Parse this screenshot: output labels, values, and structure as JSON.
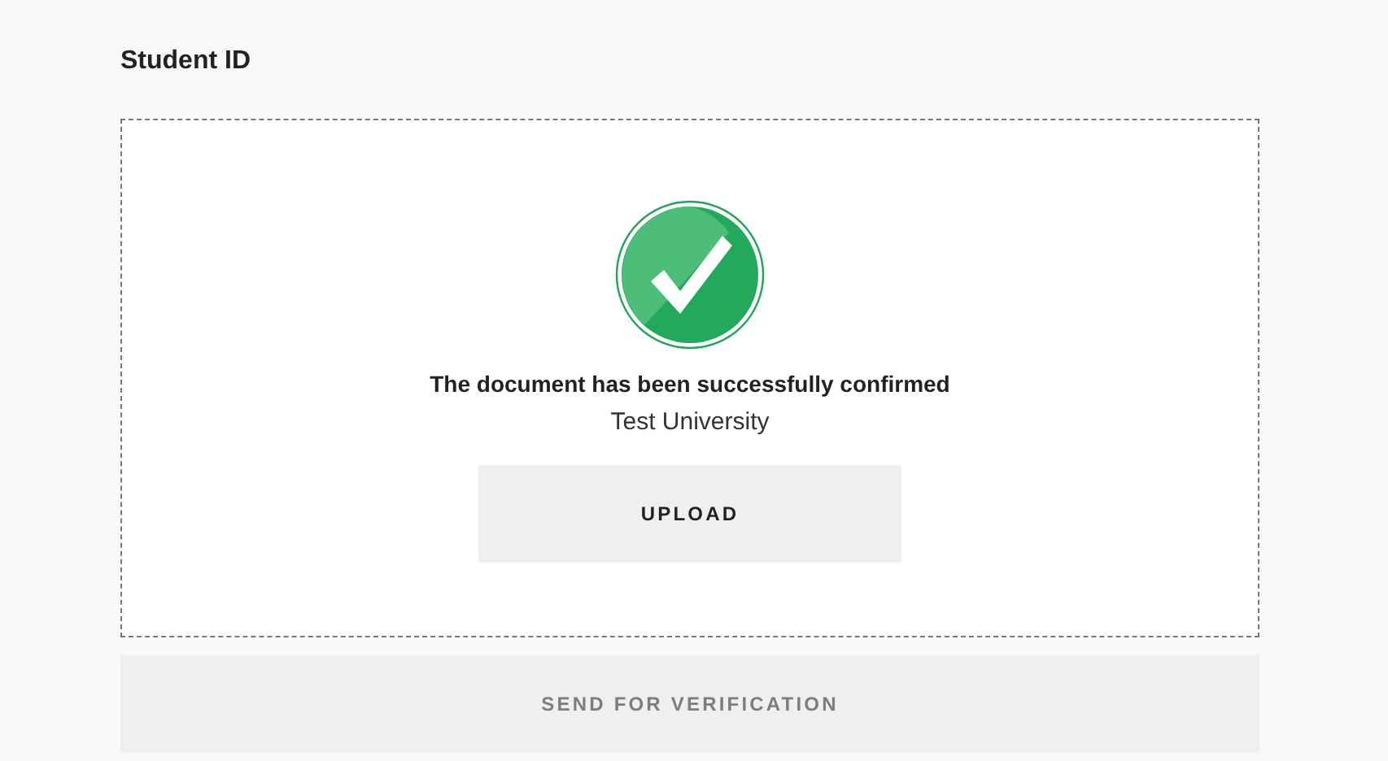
{
  "section": {
    "title": "Student ID"
  },
  "upload_area": {
    "kind": "confirmed",
    "message": "The document has been successfully confirmed",
    "institution": "Test University",
    "upload_button": "UPLOAD"
  },
  "submit_button": {
    "label": "SEND FOR VERIFICATION",
    "disabled": true
  }
}
